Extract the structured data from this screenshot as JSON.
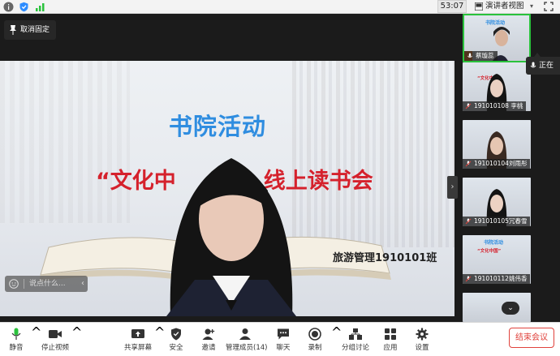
{
  "topbar": {
    "timer": "53:07",
    "view_label": "演讲者视图",
    "view_caret": "▾"
  },
  "main": {
    "unpin_label": "取消固定",
    "slide_title": "书院活动",
    "slide_subtitle": "“文化中",
    "slide_subtitle_2": "线上读书会",
    "slide_class": "旅游管理1910101班",
    "chat_placeholder": "说点什么...",
    "chat_arrow": "‹",
    "collapse_arrow": "›"
  },
  "thumbnails": [
    {
      "name": "蔡璇蕊",
      "active": true
    },
    {
      "name": "191010108 李桃",
      "active": false
    },
    {
      "name": "191010104刘雨彤",
      "active": false
    },
    {
      "name": "191010105冗春雪",
      "active": false
    },
    {
      "name": "191010112姚伟香",
      "active": false
    },
    {
      "name": "",
      "active": false
    }
  ],
  "thumb_slide": {
    "title": "书院活动",
    "subtitle": "“文化中国”"
  },
  "tooltip": {
    "label": "正在"
  },
  "scroll_down": "⌄",
  "toolbar": {
    "mute": "静音",
    "stop_video": "停止视频",
    "share": "共享屏幕",
    "security": "安全",
    "invite": "邀请",
    "members": "管理成员(14)",
    "chat": "聊天",
    "record": "录制",
    "breakout": "分组讨论",
    "apps": "应用",
    "settings": "设置",
    "end": "结束会议",
    "caret": "^"
  },
  "colors": {
    "accent_green": "#2ac23c",
    "end_red": "#e0423c",
    "title_blue": "#2f8de0",
    "subtitle_red": "#d5212c"
  }
}
